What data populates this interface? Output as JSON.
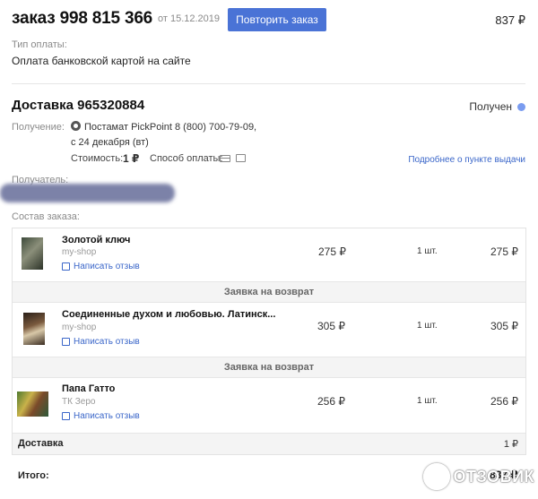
{
  "header": {
    "order_title": "заказ 998 815 366",
    "order_date": "от 15.12.2019",
    "repeat_label": "Повторить заказ",
    "total": "837 ₽"
  },
  "payment": {
    "label": "Тип оплаты:",
    "value": "Оплата банковской картой на сайте"
  },
  "delivery": {
    "title": "Доставка 965320884",
    "status": "Получен",
    "status_color": "#7a9cf0",
    "pickup_label": "Получение:",
    "pickup_line1": "Постамат PickPoint 8 (800) 700-79-09,",
    "pickup_line2": "с 24 декабря (вт)",
    "cost_label": "Стоимость:",
    "cost_value": "1 ₽",
    "pay_method_label": "Способ оплаты:",
    "details_link": "Подробнее о пункте выдачи",
    "recipient_label": "Получатель:"
  },
  "composition_label": "Состав заказа:",
  "items": [
    {
      "title": "Золотой ключ",
      "shop": "my-shop",
      "review": "Написать отзыв",
      "price": "275 ₽",
      "qty": "1 шт.",
      "sum": "275 ₽"
    },
    {
      "title": "Соединенные духом и любовью. Латинск...",
      "shop": "my-shop",
      "review": "Написать отзыв",
      "price": "305 ₽",
      "qty": "1 шт.",
      "sum": "305 ₽"
    },
    {
      "title": "Папа Гатто",
      "shop": "ТК Зеро",
      "review": "Написать отзыв",
      "price": "256 ₽",
      "qty": "1 шт.",
      "sum": "256 ₽"
    }
  ],
  "return_label": "Заявка на возврат",
  "shipping_row": {
    "label": "Доставка",
    "value": "1 ₽"
  },
  "total_row": {
    "label": "Итого:",
    "value": "837 ₽"
  },
  "watermark": "ОТЗОВИК",
  "colors": {
    "accent": "#4a73d6",
    "link": "#3a66c9"
  }
}
